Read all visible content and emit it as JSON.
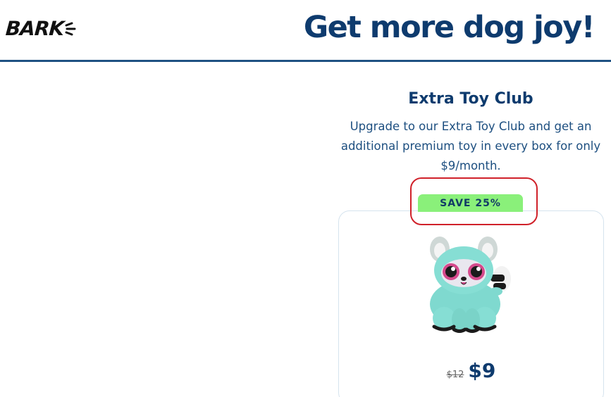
{
  "header": {
    "logo_text": "BARK",
    "title": "Get more dog joy!"
  },
  "offer": {
    "title": "Extra Toy Club",
    "description": "Upgrade to our Extra Toy Club and get an additional premium toy in every box for only $9/month.",
    "badge": "SAVE 25%",
    "old_price": "$12",
    "new_price": "$9",
    "image": "plush-raccoon-toy"
  },
  "colors": {
    "brand_navy": "#0e3b6e",
    "badge_green": "#8af07a",
    "highlight_red": "#d0212a",
    "header_rule": "#1f5183"
  }
}
